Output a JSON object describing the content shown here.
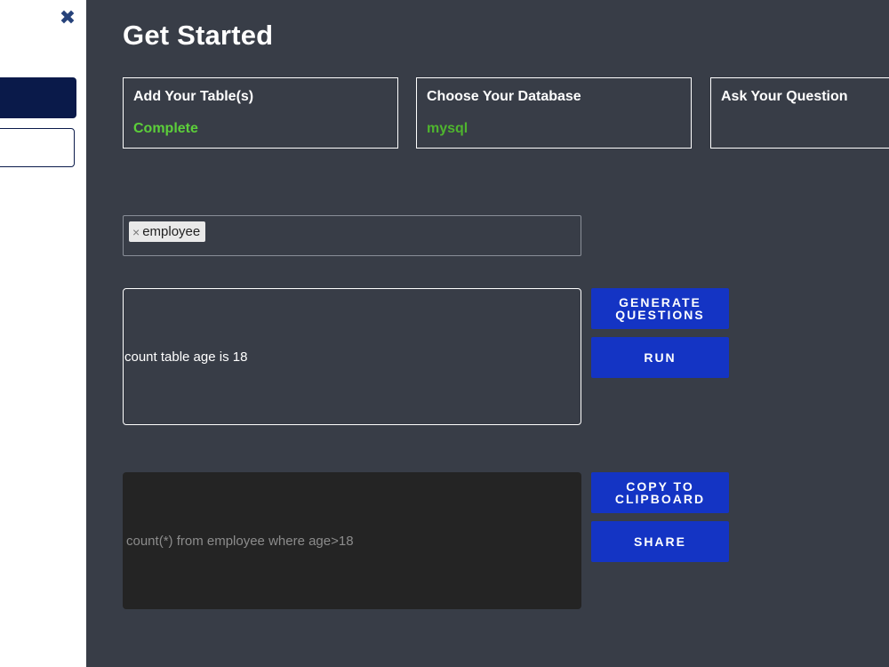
{
  "sidebar": {
    "close_icon": "close-icon",
    "close_glyph": "✖"
  },
  "main": {
    "title": "Get Started",
    "steps": [
      {
        "title": "Add Your Table(s)",
        "status": "Complete"
      },
      {
        "title": "Choose Your Database",
        "status": "mysql"
      },
      {
        "title": "Ask Your Question",
        "status": ""
      }
    ],
    "tables": {
      "tags": [
        {
          "label": "employee",
          "remove_glyph": "×"
        }
      ]
    },
    "question": {
      "value": "count table age is 18"
    },
    "result": {
      "value": "count(*) from employee where age>18"
    },
    "buttons": {
      "generate_questions": "GENERATE QUESTIONS",
      "run": "RUN",
      "copy_to_clipboard": "COPY TO CLIPBOARD",
      "share": "SHARE"
    }
  },
  "colors": {
    "background": "#383d47",
    "accent_blue": "#1434c4",
    "status_green": "#5ccf3a",
    "sidebar_navy": "#0a1a4a"
  }
}
